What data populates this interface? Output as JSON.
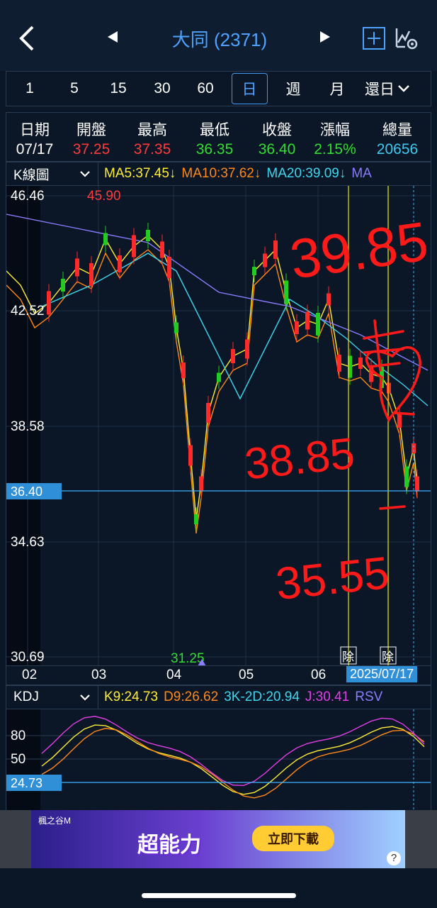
{
  "header": {
    "title": "大同 (2371)"
  },
  "tabs": [
    "1",
    "5",
    "15",
    "30",
    "60",
    "日",
    "週",
    "月",
    "還日"
  ],
  "quote": {
    "labels": [
      "日期",
      "開盤",
      "最高",
      "最低",
      "收盤",
      "漲幅",
      "總量"
    ],
    "values": [
      "07/17",
      "37.25",
      "37.35",
      "36.35",
      "36.40",
      "2.15%",
      "20656"
    ],
    "colors": [
      "#ffffff",
      "#ff3b3b",
      "#ff3b3b",
      "#33dd33",
      "#33dd33",
      "#33dd33",
      "#3fc9f0"
    ]
  },
  "kline": {
    "selector": "K線圖",
    "ma5": "MA5:37.45↓",
    "ma10": "MA10:37.62↓",
    "ma20": "MA20:39.09↓",
    "ma_more": "MA",
    "y_labels": [
      "46.46",
      "42.52",
      "38.58",
      "34.63",
      "30.69"
    ],
    "current_price": "36.40",
    "high_label": "45.90",
    "low_label": "31.25",
    "ex_div_label": "除",
    "colors": {
      "up": "#ff2a2a",
      "down": "#22cc22",
      "ma5": "#ffee33",
      "ma10": "#ff8a1a",
      "ma20": "#3fd6ee",
      "ma60": "#8a7cff",
      "price_line": "#3fb4ff"
    }
  },
  "xaxis": {
    "months": [
      "02",
      "03",
      "04",
      "05",
      "06"
    ],
    "date_badge": "2025/07/17"
  },
  "kdj": {
    "selector": "KDJ",
    "k": "K9:24.73",
    "d": "D9:26.62",
    "k2d": "3K-2D:20.94",
    "j": "J:30.41",
    "rsv": "RSV",
    "y_labels": [
      "80",
      "50"
    ],
    "current": "24.73"
  },
  "annotations": [
    "39.85",
    "38.85",
    "35.55"
  ],
  "ad": {
    "brand": "楓之谷M",
    "headline": "超能力",
    "button": "立即下載"
  }
}
